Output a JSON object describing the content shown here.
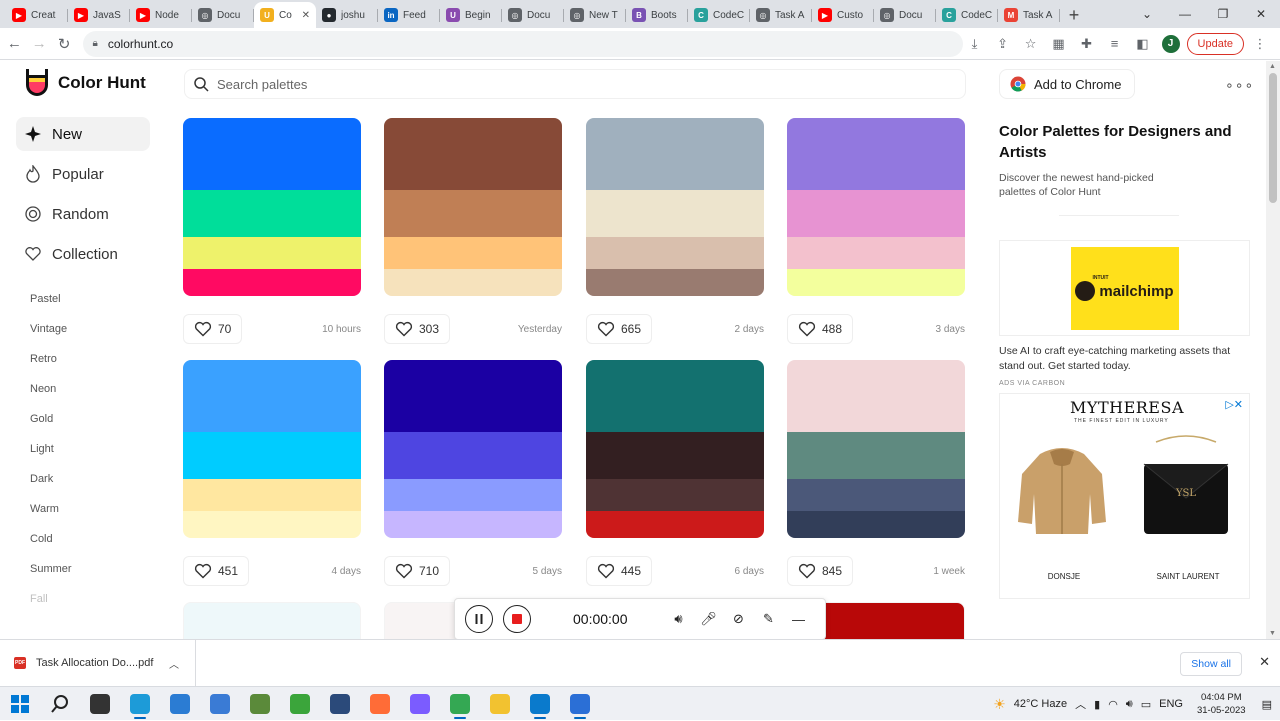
{
  "browser": {
    "tabs": [
      {
        "label": "Creat",
        "color": "#ff0000",
        "glyph": "▶"
      },
      {
        "label": "JavaS",
        "color": "#ff0000",
        "glyph": "▶"
      },
      {
        "label": "Node",
        "color": "#ff0000",
        "glyph": "▶"
      },
      {
        "label": "Docu",
        "color": "#5f6368",
        "glyph": "◎"
      },
      {
        "label": "Co",
        "color": "#f2b01e",
        "glyph": "U",
        "active": true
      },
      {
        "label": "joshu",
        "color": "#24292e",
        "glyph": "●"
      },
      {
        "label": "Feed",
        "color": "#0a66c2",
        "glyph": "in"
      },
      {
        "label": "Begin",
        "color": "#8a4baf",
        "glyph": "U"
      },
      {
        "label": "Docu",
        "color": "#5f6368",
        "glyph": "◎"
      },
      {
        "label": "New T",
        "color": "#5f6368",
        "glyph": "◎"
      },
      {
        "label": "Boots",
        "color": "#7952b3",
        "glyph": "B"
      },
      {
        "label": "CodeC",
        "color": "#29a19c",
        "glyph": "C"
      },
      {
        "label": "Task A",
        "color": "#5f6368",
        "glyph": "◎"
      },
      {
        "label": "Custo",
        "color": "#ff0000",
        "glyph": "▶"
      },
      {
        "label": "Docu",
        "color": "#5f6368",
        "glyph": "◎"
      },
      {
        "label": "CodeC",
        "color": "#29a19c",
        "glyph": "C"
      },
      {
        "label": "Task A",
        "color": "#ea4335",
        "glyph": "M"
      }
    ],
    "url": "colorhunt.co",
    "update_label": "Update",
    "profile_initial": "J"
  },
  "site": {
    "name": "Color Hunt",
    "search_placeholder": "Search palettes",
    "nav": [
      {
        "label": "New",
        "icon": "sparkle-icon",
        "active": true
      },
      {
        "label": "Popular",
        "icon": "flame-icon"
      },
      {
        "label": "Random",
        "icon": "spiral-icon"
      },
      {
        "label": "Collection",
        "icon": "heart-icon"
      }
    ],
    "tags": [
      "Pastel",
      "Vintage",
      "Retro",
      "Neon",
      "Gold",
      "Light",
      "Dark",
      "Warm",
      "Cold",
      "Summer",
      "Fall"
    ],
    "palettes": [
      {
        "colors": [
          "#0a6cff",
          "#00de9a",
          "#eef26b",
          "#ff0a62"
        ],
        "likes": "70",
        "date": "10 hours"
      },
      {
        "colors": [
          "#874a37",
          "#c07f55",
          "#ffc378",
          "#f6e2bc"
        ],
        "likes": "303",
        "date": "Yesterday"
      },
      {
        "colors": [
          "#a0b0be",
          "#ede4cd",
          "#d9bfad",
          "#997b70"
        ],
        "likes": "665",
        "date": "2 days"
      },
      {
        "colors": [
          "#9278df",
          "#e793d2",
          "#f3c1cd",
          "#f3ff9d"
        ],
        "likes": "488",
        "date": "3 days"
      },
      {
        "colors": [
          "#3aa1ff",
          "#00ccff",
          "#ffe7a0",
          "#fff6c2"
        ],
        "likes": "451",
        "date": "4 days"
      },
      {
        "colors": [
          "#1b00a3",
          "#4e45e1",
          "#8a9bff",
          "#c6b6ff"
        ],
        "likes": "710",
        "date": "5 days"
      },
      {
        "colors": [
          "#13716f",
          "#331f21",
          "#4f3334",
          "#cc1a1a"
        ],
        "likes": "445",
        "date": "6 days"
      },
      {
        "colors": [
          "#f2d7d9",
          "#5f8a80",
          "#4b5879",
          "#323e59"
        ],
        "likes": "845",
        "date": "1 week"
      }
    ],
    "partial_row": [
      "#eef8fa",
      "#f8f4f4",
      "#ffffff",
      "#b80808"
    ],
    "right": {
      "add_to_chrome": "Add to Chrome",
      "title": "Color Palettes for Designers and Artists",
      "subtitle": "Discover the newest hand-picked palettes of Color Hunt",
      "ad_brand_small": "INTUIT",
      "ad_brand": "mailchimp",
      "ad_copy": "Use AI to craft eye-catching marketing assets that stand out. Get started today.",
      "ad_via": "ADS VIA CARBON",
      "ad2_brand": "MYTHERESA",
      "ad2_tagline": "THE FINEST EDIT IN LUXURY",
      "ad2_products": [
        "DONSJE",
        "SAINT LAURENT"
      ]
    }
  },
  "recorder": {
    "time": "00:00:00"
  },
  "download": {
    "filename": "Task Allocation Do....pdf",
    "pdf_badge": "PDF",
    "show_all": "Show all"
  },
  "taskbar": {
    "weather": "42°C  Haze",
    "lang": "ENG",
    "time": "04:04 PM",
    "date": "31-05-2023",
    "apps": [
      {
        "name": "start-icon",
        "color": "#0078d4"
      },
      {
        "name": "search-icon",
        "color": "#222222"
      },
      {
        "name": "task-view-icon",
        "color": "#333333"
      },
      {
        "name": "edge-icon",
        "color": "#1d9bd8",
        "running": true
      },
      {
        "name": "mail-icon",
        "color": "#2b7cd3"
      },
      {
        "name": "ms-store-icon",
        "color": "#3a7bd5"
      },
      {
        "name": "photos-icon",
        "color": "#5b8a3a"
      },
      {
        "name": "greenshot-icon",
        "color": "#3ba53b"
      },
      {
        "name": "app-icon",
        "color": "#2b4a7a"
      },
      {
        "name": "postman-icon",
        "color": "#ff6c37"
      },
      {
        "name": "vpn-icon",
        "color": "#7b5cff"
      },
      {
        "name": "chrome-icon",
        "color": "#34a853",
        "running": true
      },
      {
        "name": "file-explorer-icon",
        "color": "#f2c230"
      },
      {
        "name": "vscode-icon",
        "color": "#0a7acc",
        "running": true
      },
      {
        "name": "recorder-icon",
        "color": "#2b6fd6",
        "running": true
      }
    ]
  }
}
